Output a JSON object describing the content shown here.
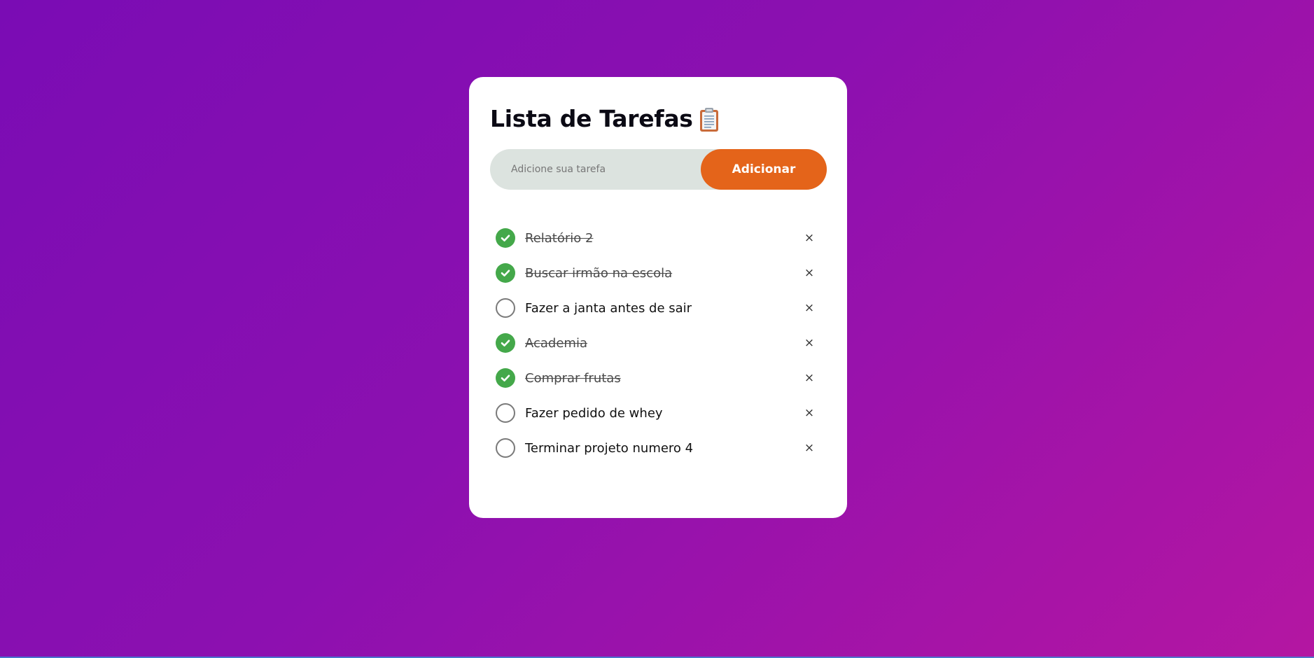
{
  "app": {
    "title": "Lista de Tarefas",
    "title_icon": "clipboard-icon"
  },
  "input": {
    "placeholder": "Adicione sua tarefa",
    "value": ""
  },
  "add_button": {
    "label": "Adicionar"
  },
  "tasks": [
    {
      "text": "Relatório 2",
      "done": true
    },
    {
      "text": "Buscar irmão na escola",
      "done": true
    },
    {
      "text": "Fazer a janta antes de sair",
      "done": false
    },
    {
      "text": "Academia",
      "done": true
    },
    {
      "text": "Comprar frutas",
      "done": true
    },
    {
      "text": "Fazer pedido de whey",
      "done": false
    },
    {
      "text": "Terminar projeto numero 4",
      "done": false
    }
  ],
  "delete_glyph": "×",
  "colors": {
    "background_start": "#7a0cb4",
    "background_end": "#b416a2",
    "card": "#ffffff",
    "input_bg": "#dce3df",
    "accent": "#e4641a",
    "checked": "#44a84a",
    "unchecked_border": "#7a7a7a"
  },
  "icons": {
    "checked": "check-circle-icon",
    "unchecked": "empty-circle-icon",
    "delete": "close-icon"
  }
}
